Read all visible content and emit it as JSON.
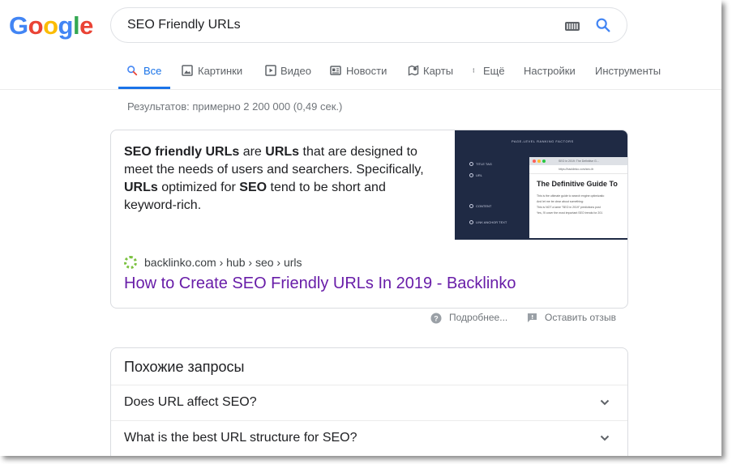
{
  "logo": [
    "G",
    "o",
    "o",
    "g",
    "l",
    "e"
  ],
  "search": {
    "query": "SEO Friendly URLs"
  },
  "tabs": [
    {
      "label": "Все",
      "icon": "search-icon"
    },
    {
      "label": "Картинки",
      "icon": "image-icon"
    },
    {
      "label": "Видео",
      "icon": "video-icon"
    },
    {
      "label": "Новости",
      "icon": "news-icon"
    },
    {
      "label": "Карты",
      "icon": "map-icon"
    },
    {
      "label": "Ещё",
      "icon": "more-vert-icon"
    },
    {
      "label": "Настройки"
    },
    {
      "label": "Инструменты"
    }
  ],
  "stats": "Результатов: примерно 2 200 000 (0,49 сек.)",
  "snippet": {
    "parts": [
      {
        "t": "SEO friendly URLs",
        "b": true
      },
      {
        "t": " are ",
        "b": false
      },
      {
        "t": "URLs",
        "b": true
      },
      {
        "t": " that are designed to meet the needs of users and searchers. Specifically, ",
        "b": false
      },
      {
        "t": "URLs",
        "b": true
      },
      {
        "t": " optimized for ",
        "b": false
      },
      {
        "t": "SEO",
        "b": true
      },
      {
        "t": " tend to be short and keyword-rich.",
        "b": false
      }
    ],
    "thumbnail": {
      "header": "PAGE-LEVEL RANKING FACTORS",
      "side": [
        "TITLE TAG",
        "URL",
        "CONTENT",
        "LINK ANCHOR TEXT"
      ],
      "tab_title": "SEO in 2019: The Definitive G...",
      "address": "https://backlinko.com/seo-th",
      "heading": "The Definitive Guide To",
      "lines": [
        "This is the ultimate guide to search engine optimizatio",
        "And let me be clear about something:",
        "This is NOT a lame \"SEO in 2019\" predictions post",
        "Yes, I'll cover the most important SEO trends for 201"
      ]
    },
    "cite": "backlinko.com › hub › seo › urls",
    "link": "How to Create SEO Friendly URLs In 2019 - Backlinko"
  },
  "feedback": {
    "more": "Подробнее...",
    "send": "Оставить отзыв"
  },
  "related": {
    "title": "Похожие запросы",
    "questions": [
      "Does URL affect SEO?",
      "What is the best URL structure for SEO?"
    ]
  },
  "colors": {
    "accent": "#1a73e8",
    "visited_link": "#681da8",
    "muted": "#70757a"
  }
}
